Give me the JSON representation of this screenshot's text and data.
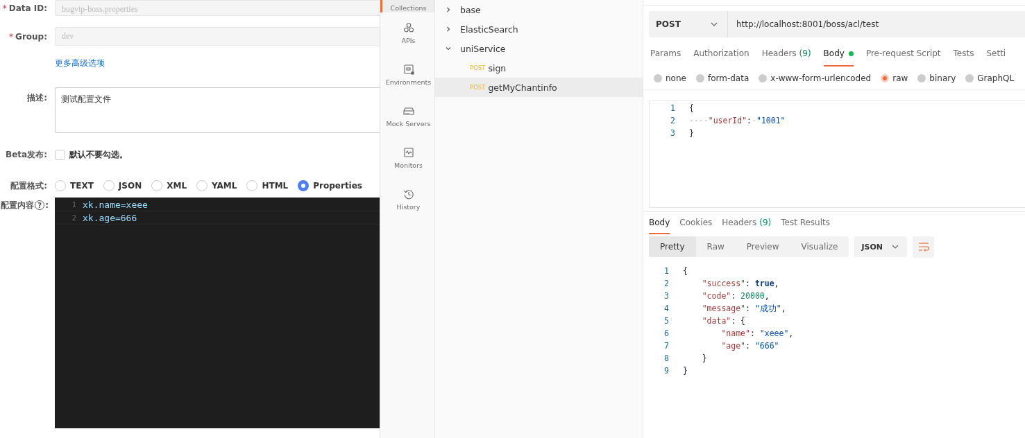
{
  "config_form": {
    "data_id": {
      "marker": "*",
      "label": "Data ID:",
      "value": "bugvip-boss.properties",
      "disabled": true
    },
    "group": {
      "marker": "*",
      "label": "Group:",
      "value": "dev",
      "disabled": true
    },
    "advanced_link": "更多高级选项",
    "description": {
      "label": "描述:",
      "value": "测试配置文件"
    },
    "beta": {
      "label": "Beta发布:",
      "checked": false,
      "text": "默认不要勾选。"
    },
    "format": {
      "label": "配置格式:",
      "options": [
        {
          "label": "TEXT",
          "selected": false
        },
        {
          "label": "JSON",
          "selected": false
        },
        {
          "label": "XML",
          "selected": false
        },
        {
          "label": "YAML",
          "selected": false
        },
        {
          "label": "HTML",
          "selected": false
        },
        {
          "label": "Properties",
          "selected": true
        }
      ]
    },
    "content": {
      "label": "配置内容",
      "help": "?",
      "suffix": ":",
      "lines": [
        {
          "n": "1",
          "text": "xk.name=xeee"
        },
        {
          "n": "2",
          "text": "xk.age=666"
        }
      ]
    }
  },
  "nav": [
    {
      "label": "Collections",
      "selected": true
    },
    {
      "label": "APIs",
      "selected": false
    },
    {
      "label": "Environments",
      "selected": false
    },
    {
      "label": "Mock Servers",
      "selected": false
    },
    {
      "label": "Monitors",
      "selected": false
    },
    {
      "label": "History",
      "selected": false
    }
  ],
  "tree": [
    {
      "label": "base",
      "expanded": false
    },
    {
      "label": "ElasticSearch",
      "expanded": false
    },
    {
      "label": "uniService",
      "expanded": true,
      "children": [
        {
          "method": "POST",
          "label": "sign",
          "selected": false
        },
        {
          "method": "POST",
          "label": "getMyChantinfo",
          "selected": true
        }
      ]
    }
  ],
  "request": {
    "method": "POST",
    "url": "http://localhost:8001/boss/acl/test",
    "tabs": [
      {
        "label": "Params",
        "selected": false
      },
      {
        "label": "Authorization",
        "selected": false
      },
      {
        "label": "Headers",
        "count": "(9)",
        "selected": false
      },
      {
        "label": "Body",
        "selected": true,
        "indicator": true
      },
      {
        "label": "Pre-request Script",
        "selected": false
      },
      {
        "label": "Tests",
        "selected": false
      },
      {
        "label": "Setti",
        "selected": false
      }
    ],
    "body_types": [
      {
        "label": "none",
        "selected": false
      },
      {
        "label": "form-data",
        "selected": false
      },
      {
        "label": "x-www-form-urlencoded",
        "selected": false
      },
      {
        "label": "raw",
        "selected": true
      },
      {
        "label": "binary",
        "selected": false
      },
      {
        "label": "GraphQL",
        "selected": false
      }
    ],
    "body_lines": [
      {
        "n": "1",
        "tokens": [
          {
            "text": "{",
            "kind": "punct"
          }
        ]
      },
      {
        "n": "2",
        "tokens": [
          {
            "text": "····",
            "kind": "space"
          },
          {
            "text": "\"userId\"",
            "kind": "key"
          },
          {
            "text": ":",
            "kind": "punct"
          },
          {
            "text": "·",
            "kind": "space"
          },
          {
            "text": "\"1001\"",
            "kind": "string"
          }
        ]
      },
      {
        "n": "3",
        "tokens": [
          {
            "text": "}",
            "kind": "punct"
          }
        ]
      }
    ]
  },
  "response": {
    "tabs": [
      {
        "label": "Body",
        "selected": true
      },
      {
        "label": "Cookies",
        "selected": false
      },
      {
        "label": "Headers",
        "count": "(9)",
        "selected": false
      },
      {
        "label": "Test Results",
        "selected": false
      }
    ],
    "view_modes": [
      {
        "label": "Pretty",
        "selected": true
      },
      {
        "label": "Raw",
        "selected": false
      },
      {
        "label": "Preview",
        "selected": false
      },
      {
        "label": "Visualize",
        "selected": false
      }
    ],
    "format": "JSON",
    "lines": [
      {
        "n": "1",
        "tokens": [
          {
            "text": "{",
            "kind": "punct"
          }
        ]
      },
      {
        "n": "2",
        "tokens": [
          {
            "text": "    \"success\"",
            "kind": "key"
          },
          {
            "text": ": ",
            "kind": "punct"
          },
          {
            "text": "true",
            "kind": "bool"
          },
          {
            "text": ",",
            "kind": "punct"
          }
        ]
      },
      {
        "n": "3",
        "tokens": [
          {
            "text": "    \"code\"",
            "kind": "key"
          },
          {
            "text": ": ",
            "kind": "punct"
          },
          {
            "text": "20000",
            "kind": "number"
          },
          {
            "text": ",",
            "kind": "punct"
          }
        ]
      },
      {
        "n": "4",
        "tokens": [
          {
            "text": "    \"message\"",
            "kind": "key"
          },
          {
            "text": ": ",
            "kind": "punct"
          },
          {
            "text": "\"成功\"",
            "kind": "string"
          },
          {
            "text": ",",
            "kind": "punct"
          }
        ]
      },
      {
        "n": "5",
        "tokens": [
          {
            "text": "    \"data\"",
            "kind": "key"
          },
          {
            "text": ": {",
            "kind": "punct"
          }
        ]
      },
      {
        "n": "6",
        "tokens": [
          {
            "text": "        \"name\"",
            "kind": "key"
          },
          {
            "text": ": ",
            "kind": "punct"
          },
          {
            "text": "\"xeee\"",
            "kind": "string"
          },
          {
            "text": ",",
            "kind": "punct"
          }
        ]
      },
      {
        "n": "7",
        "tokens": [
          {
            "text": "        \"age\"",
            "kind": "key"
          },
          {
            "text": ": ",
            "kind": "punct"
          },
          {
            "text": "\"666\"",
            "kind": "string"
          }
        ]
      },
      {
        "n": "8",
        "tokens": [
          {
            "text": "    }",
            "kind": "punct"
          }
        ]
      },
      {
        "n": "9",
        "tokens": [
          {
            "text": "}",
            "kind": "punct"
          }
        ]
      }
    ]
  }
}
